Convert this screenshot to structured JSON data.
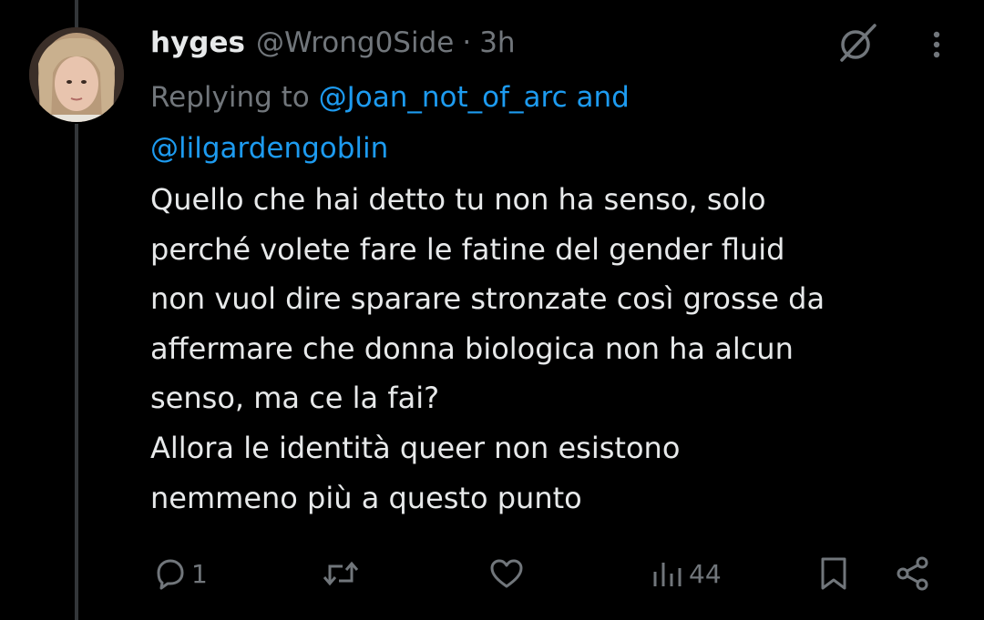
{
  "tweet": {
    "author_name": "hyges",
    "author_handle": "@Wrong0Side",
    "separator": "·",
    "time": "3h",
    "replying_prefix": "Replying to ",
    "mention_1": "@Joan_not_of_arc",
    "mention_joiner": " and",
    "mention_2": "@lilgardengoblin",
    "text_lines": [
      "Quello che hai detto tu non ha senso, solo",
      "perché volete fare le fatine del gender fluid",
      "non vuol dire sparare stronzate così grosse da",
      "affermare che donna biologica non ha alcun",
      "senso, ma ce la fai?",
      "Allora le identità queer non esistono",
      "nemmeno più a questo punto"
    ]
  },
  "actions": {
    "reply": {
      "icon": "reply-icon",
      "count": "1"
    },
    "retweet": {
      "icon": "retweet-icon",
      "count": ""
    },
    "like": {
      "icon": "heart-icon",
      "count": ""
    },
    "views": {
      "icon": "views-icon",
      "count": "44"
    },
    "bookmark": {
      "icon": "bookmark-icon"
    },
    "share": {
      "icon": "share-icon"
    }
  },
  "header_icons": {
    "grok": "grok-icon",
    "more": "more-icon"
  },
  "colors": {
    "background": "#000000",
    "primary_text": "#e7e9ea",
    "secondary_text": "#71767b",
    "link": "#1d9bf0",
    "thread_line": "#333639"
  }
}
